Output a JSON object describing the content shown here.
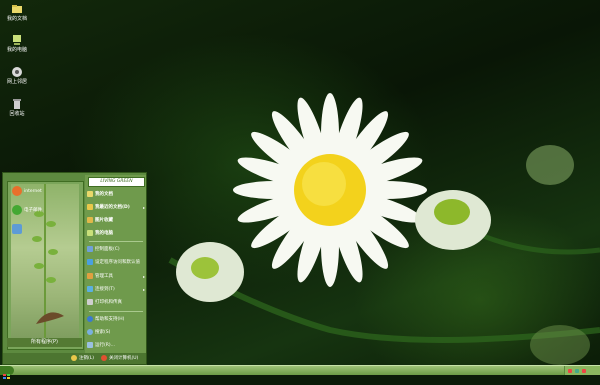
{
  "desktop": {
    "icons": [
      {
        "label": "我的文档",
        "icon": "folder-icon",
        "color": "#e9d86a"
      },
      {
        "label": "我的电脑",
        "icon": "computer-icon",
        "color": "#c9e07a"
      },
      {
        "label": "网上邻居",
        "icon": "network-icon",
        "color": "#d9d9d9"
      },
      {
        "label": "回收站",
        "icon": "recycle-bin-icon",
        "color": "#cfcfcf"
      }
    ]
  },
  "start_menu": {
    "logo_text": "LIVING GREEN",
    "pinned": [
      {
        "label": "internet",
        "icon": "browser-icon",
        "color": "#e86f2b"
      },
      {
        "label": "电子邮件",
        "icon": "email-icon",
        "color": "#43a832"
      },
      {
        "label": "",
        "icon": "documents-icon",
        "color": "#5d9bd6"
      }
    ],
    "all_programs": "所有程序(P)",
    "right_items": [
      {
        "label": "我的文档",
        "icon": "folder-icon",
        "bold": true,
        "arrow": ""
      },
      {
        "label": "我最近的文档(D)",
        "icon": "recent-docs-icon",
        "bold": true,
        "arrow": "▸"
      },
      {
        "label": "图片收藏",
        "icon": "pictures-icon",
        "bold": true,
        "arrow": ""
      },
      {
        "label": "我的电脑",
        "icon": "computer-icon",
        "bold": true,
        "arrow": ""
      },
      {
        "label": "控制面板(C)",
        "icon": "control-panel-icon",
        "bold": false,
        "arrow": ""
      },
      {
        "label": "设定程序访问和默认值",
        "icon": "program-access-icon",
        "bold": false,
        "arrow": ""
      },
      {
        "label": "管理工具",
        "icon": "admin-tools-icon",
        "bold": false,
        "arrow": "▸"
      },
      {
        "label": "连接到(T)",
        "icon": "connect-icon",
        "bold": false,
        "arrow": "▸"
      },
      {
        "label": "打印机和传真",
        "icon": "printer-icon",
        "bold": false,
        "arrow": ""
      },
      {
        "label": "帮助和支持(H)",
        "icon": "help-icon",
        "bold": false,
        "arrow": ""
      },
      {
        "label": "搜索(S)",
        "icon": "search-icon",
        "bold": false,
        "arrow": ""
      },
      {
        "label": "运行(R)...",
        "icon": "run-icon",
        "bold": false,
        "arrow": ""
      }
    ],
    "footer": {
      "logoff": "注销(L)",
      "shutdown": "关闭计算机(U)"
    }
  },
  "taskbar": {
    "start_label": "",
    "tray_icons": [
      "tray-icon",
      "tray-icon",
      "tray-icon"
    ]
  }
}
